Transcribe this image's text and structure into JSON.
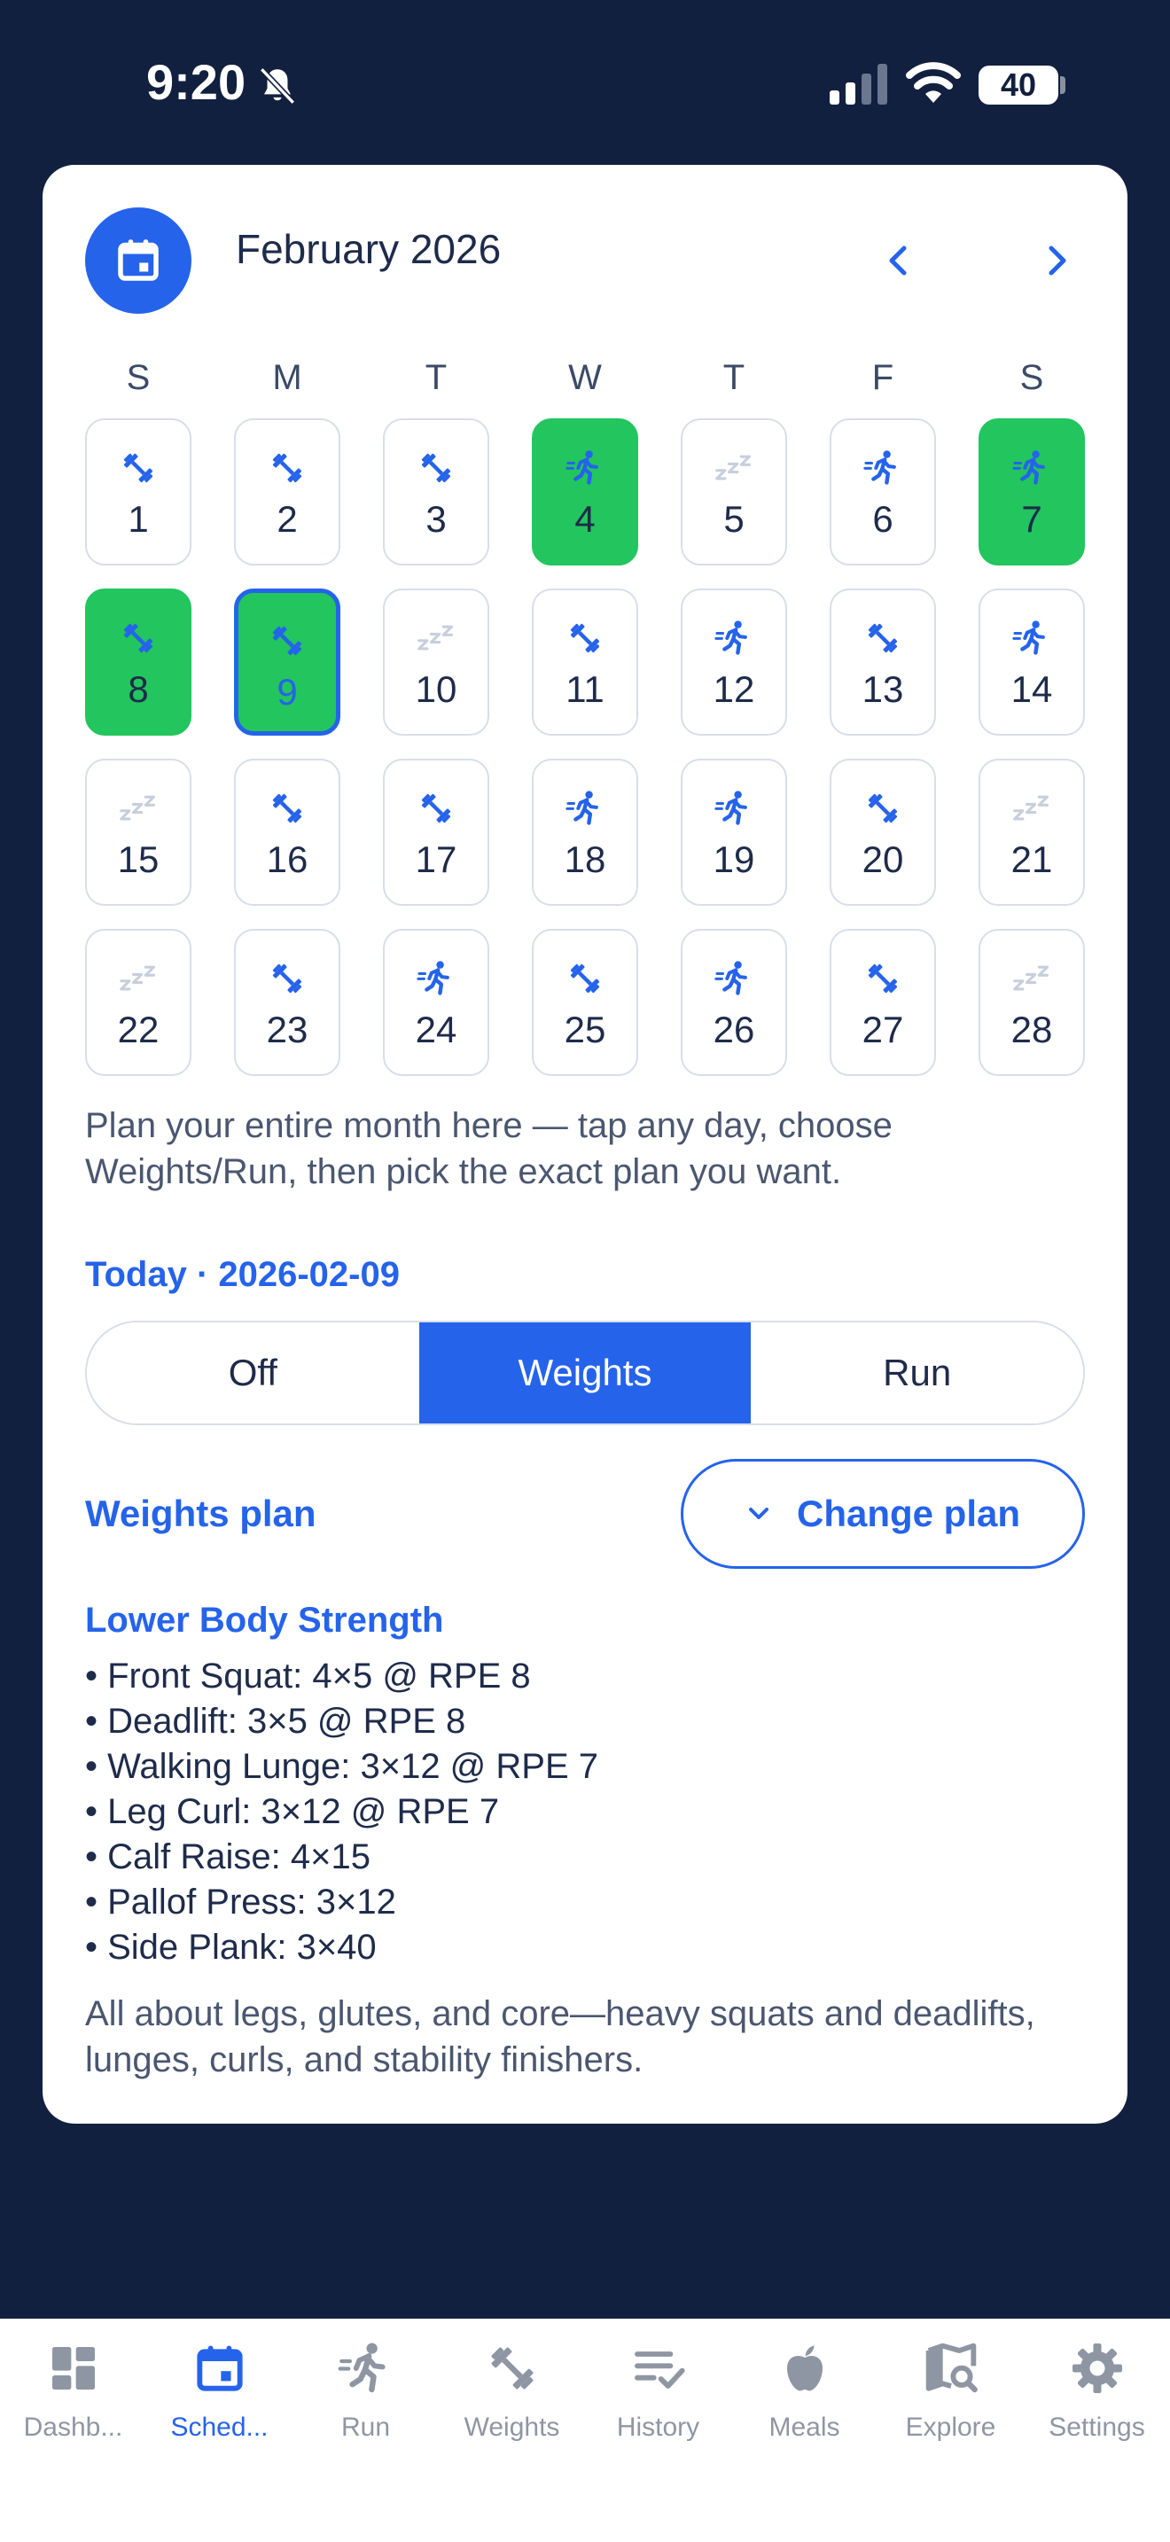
{
  "status_bar": {
    "time": "9:20",
    "battery": "40"
  },
  "calendar": {
    "month_title": "February 2026",
    "weekdays": [
      "S",
      "M",
      "T",
      "W",
      "T",
      "F",
      "S"
    ],
    "days": [
      {
        "num": "1",
        "type": "weights",
        "state": "normal"
      },
      {
        "num": "2",
        "type": "weights",
        "state": "normal"
      },
      {
        "num": "3",
        "type": "weights",
        "state": "normal"
      },
      {
        "num": "4",
        "type": "run",
        "state": "done"
      },
      {
        "num": "5",
        "type": "off",
        "state": "normal"
      },
      {
        "num": "6",
        "type": "run",
        "state": "normal"
      },
      {
        "num": "7",
        "type": "run",
        "state": "done"
      },
      {
        "num": "8",
        "type": "weights",
        "state": "done"
      },
      {
        "num": "9",
        "type": "weights",
        "state": "today"
      },
      {
        "num": "10",
        "type": "off",
        "state": "normal"
      },
      {
        "num": "11",
        "type": "weights",
        "state": "normal"
      },
      {
        "num": "12",
        "type": "run",
        "state": "normal"
      },
      {
        "num": "13",
        "type": "weights",
        "state": "normal"
      },
      {
        "num": "14",
        "type": "run",
        "state": "normal"
      },
      {
        "num": "15",
        "type": "off",
        "state": "normal"
      },
      {
        "num": "16",
        "type": "weights",
        "state": "normal"
      },
      {
        "num": "17",
        "type": "weights",
        "state": "normal"
      },
      {
        "num": "18",
        "type": "run",
        "state": "normal"
      },
      {
        "num": "19",
        "type": "run",
        "state": "normal"
      },
      {
        "num": "20",
        "type": "weights",
        "state": "normal"
      },
      {
        "num": "21",
        "type": "off",
        "state": "normal"
      },
      {
        "num": "22",
        "type": "off",
        "state": "normal"
      },
      {
        "num": "23",
        "type": "weights",
        "state": "normal"
      },
      {
        "num": "24",
        "type": "run",
        "state": "normal"
      },
      {
        "num": "25",
        "type": "weights",
        "state": "normal"
      },
      {
        "num": "26",
        "type": "run",
        "state": "normal"
      },
      {
        "num": "27",
        "type": "weights",
        "state": "normal"
      },
      {
        "num": "28",
        "type": "off",
        "state": "normal"
      }
    ],
    "note": "Plan your entire month here — tap any day, choose Weights/Run, then pick the exact plan you want."
  },
  "today": {
    "label": "Today · 2026-02-09",
    "segments": [
      "Off",
      "Weights",
      "Run"
    ],
    "selected_segment": "Weights"
  },
  "plan": {
    "section_label": "Weights plan",
    "change_button": "Change plan",
    "name": "Lower Body Strength",
    "exercises": [
      "• Front Squat: 4×5 @ RPE 8",
      "• Deadlift: 3×5 @ RPE 8",
      "• Walking Lunge: 3×12 @ RPE 7",
      "• Leg Curl: 3×12 @ RPE 7",
      "• Calf Raise: 4×15",
      "• Pallof Press: 3×12",
      "• Side Plank: 3×40"
    ],
    "description": "All about legs, glutes, and core—heavy squats and deadlifts, lunges, curls, and stability finishers."
  },
  "tabbar": {
    "active": "schedule",
    "tabs": [
      {
        "id": "dashboard",
        "label": "Dashb...",
        "icon": "dashboard-icon"
      },
      {
        "id": "schedule",
        "label": "Sched...",
        "icon": "calendar-icon"
      },
      {
        "id": "run",
        "label": "Run",
        "icon": "run-icon"
      },
      {
        "id": "weights",
        "label": "Weights",
        "icon": "dumbbell-icon"
      },
      {
        "id": "history",
        "label": "History",
        "icon": "history-icon"
      },
      {
        "id": "meals",
        "label": "Meals",
        "icon": "apple-icon"
      },
      {
        "id": "explore",
        "label": "Explore",
        "icon": "map-search-icon"
      },
      {
        "id": "settings",
        "label": "Settings",
        "icon": "gear-icon"
      }
    ]
  },
  "colors": {
    "background": "#12203f",
    "accent": "#2563eb",
    "done": "#22c55e",
    "off_icon": "#c7cfdc",
    "tab_inactive": "#8f96a3"
  }
}
